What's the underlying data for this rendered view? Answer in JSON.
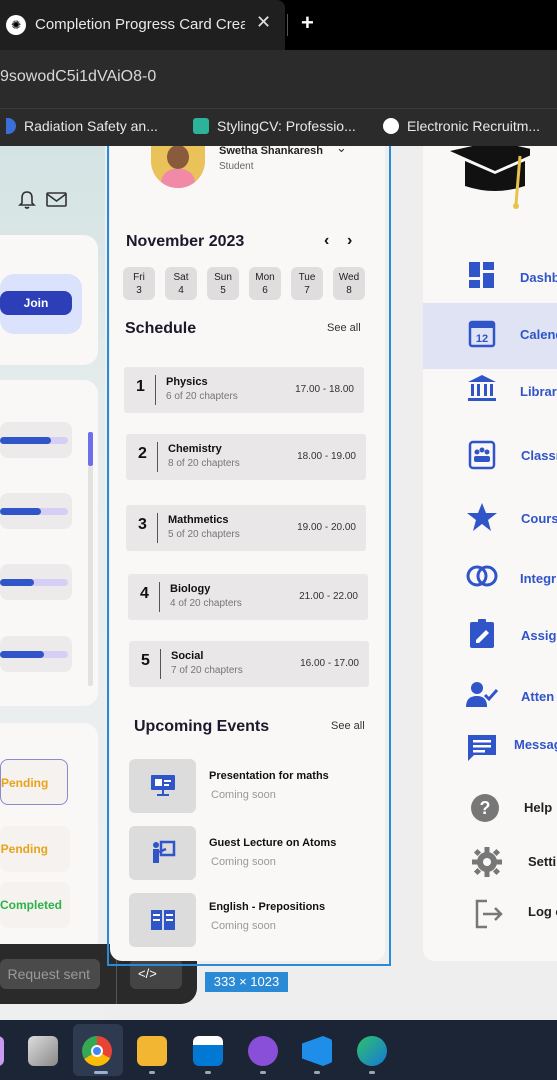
{
  "browser": {
    "tab_title": "Completion Progress Card Crea",
    "tab_close": "✕",
    "new_tab": "+",
    "url": "9sowodC5i1dVAiO8-0",
    "bookmarks": [
      {
        "label": "Radiation Safety an...",
        "icon": "bookmark-icon",
        "color": "#3b6fd8"
      },
      {
        "label": "StylingCV: Professio...",
        "icon": "stylingcv-icon",
        "color": "#2bb39b"
      },
      {
        "label": "Electronic Recruitm...",
        "icon": "globe-icon",
        "color": "#ffffff"
      }
    ]
  },
  "left": {
    "join_label": "Join",
    "statuses": [
      {
        "label": "Pending",
        "color": "#e8a317"
      },
      {
        "label": "Pending",
        "color": "#e8a317"
      },
      {
        "label": "Completed",
        "color": "#2bb34a"
      }
    ],
    "progress": [
      0.75,
      0.6,
      0.5,
      0.65
    ],
    "request_sent": "Request sent",
    "code_icon": "</>"
  },
  "profile": {
    "name": "Swetha Shankaresh",
    "role": "Student"
  },
  "calendar": {
    "month": "November 2023",
    "prev": "‹",
    "next": "›",
    "days": [
      {
        "dow": "Fri",
        "date": "3"
      },
      {
        "dow": "Sat",
        "date": "4"
      },
      {
        "dow": "Sun",
        "date": "5"
      },
      {
        "dow": "Mon",
        "date": "6"
      },
      {
        "dow": "Tue",
        "date": "7"
      },
      {
        "dow": "Wed",
        "date": "8"
      }
    ]
  },
  "schedule": {
    "title": "Schedule",
    "see_all": "See all",
    "items": [
      {
        "num": "1",
        "subject": "Physics",
        "chapters": "6 of 20 chapters",
        "time": "17.00 - 18.00"
      },
      {
        "num": "2",
        "subject": "Chemistry",
        "chapters": "8 of 20 chapters",
        "time": "18.00 - 19.00"
      },
      {
        "num": "3",
        "subject": "Mathmetics",
        "chapters": "5 of 20 chapters",
        "time": "19.00 - 20.00"
      },
      {
        "num": "4",
        "subject": "Biology",
        "chapters": "4 of 20 chapters",
        "time": "21.00 - 22.00"
      },
      {
        "num": "5",
        "subject": "Social",
        "chapters": "7 of 20 chapters",
        "time": "16.00 - 17.00"
      }
    ]
  },
  "events": {
    "title": "Upcoming Events",
    "see_all": "See all",
    "items": [
      {
        "title": "Presentation for maths",
        "sub": "Coming soon",
        "icon": "presentation-icon"
      },
      {
        "title": "Guest Lecture on Atoms",
        "sub": "Coming soon",
        "icon": "lecturer-icon"
      },
      {
        "title": "English - Prepositions",
        "sub": "Coming soon",
        "icon": "book-icon"
      }
    ]
  },
  "dimension_badge": "333 × 1023",
  "nav": {
    "items": [
      {
        "label": "Dashb",
        "icon": "dashboard-icon"
      },
      {
        "label": "Calend",
        "icon": "calendar-icon"
      },
      {
        "label": "Librar",
        "icon": "library-icon"
      },
      {
        "label": "Classr",
        "icon": "classroom-icon"
      },
      {
        "label": "Cours",
        "icon": "star-icon"
      },
      {
        "label": "Integr",
        "icon": "integration-icon"
      },
      {
        "label": "Assign",
        "icon": "assignment-icon"
      },
      {
        "label": "Atten",
        "icon": "attendance-icon"
      },
      {
        "label": "Messag",
        "icon": "message-icon"
      },
      {
        "label": "Help",
        "icon": "help-icon"
      },
      {
        "label": "Setti",
        "icon": "settings-icon"
      },
      {
        "label": "Log o",
        "icon": "logout-icon"
      }
    ]
  },
  "colors": {
    "accent": "#2f55c8",
    "join": "#2c3fb8",
    "selection": "#2a8ad6"
  }
}
